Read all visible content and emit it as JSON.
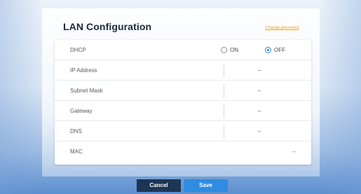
{
  "page": {
    "title": "LAN Configuration",
    "change_password_link": "Change password"
  },
  "dhcp": {
    "label": "DHCP",
    "options": [
      {
        "label": "ON",
        "selected": false
      },
      {
        "label": "OFF",
        "selected": true
      }
    ]
  },
  "fields": [
    {
      "label": "IP Address",
      "value": "--"
    },
    {
      "label": "Subnet Mask",
      "value": "--"
    },
    {
      "label": "Gateway",
      "value": "--"
    },
    {
      "label": "DNS",
      "value": "--"
    }
  ],
  "mac": {
    "label": "MAC",
    "value": "--"
  },
  "actions": {
    "cancel_label": "Cancel",
    "save_label": "Save"
  },
  "colors": {
    "accent": "#2f8ce0",
    "cancel_button": "#1e3554",
    "link": "#e8a31b",
    "title_text": "#1c2a3a"
  }
}
